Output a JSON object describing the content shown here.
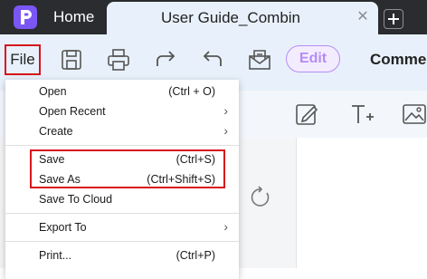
{
  "tabs": {
    "home_label": "Home",
    "active_title": "User Guide_Combin",
    "close_glyph": "✕",
    "new_tab_glyph": "+"
  },
  "toolbar": {
    "file_label": "File",
    "edit_label": "Edit",
    "comment_label": "Comme",
    "icons": [
      "save-icon",
      "print-icon",
      "redo-icon",
      "undo-icon",
      "mail-icon"
    ]
  },
  "row2": {
    "icons": [
      "edit-text-icon",
      "add-text-icon",
      "image-icon"
    ]
  },
  "menu": {
    "items": [
      {
        "label": "Open",
        "shortcut": "(Ctrl + O)",
        "submenu": false
      },
      {
        "label": "Open Recent",
        "shortcut": "",
        "submenu": true
      },
      {
        "label": "Create",
        "shortcut": "",
        "submenu": true
      },
      {
        "label": "Save",
        "shortcut": "(Ctrl+S)",
        "submenu": false
      },
      {
        "label": "Save As",
        "shortcut": "(Ctrl+Shift+S)",
        "submenu": false
      },
      {
        "label": "Save To Cloud",
        "shortcut": "",
        "submenu": false
      },
      {
        "label": "Export To",
        "shortcut": "",
        "submenu": true
      },
      {
        "label": "Print...",
        "shortcut": "(Ctrl+P)",
        "submenu": false
      }
    ],
    "arrow_glyph": "›"
  },
  "colors": {
    "highlight_red": "#d7141b",
    "edit_purple": "#b58cf6",
    "app_logo": "#7a56f5",
    "titlebar": "#2b2c30",
    "toolbar_bg": "#e8f1fb"
  }
}
